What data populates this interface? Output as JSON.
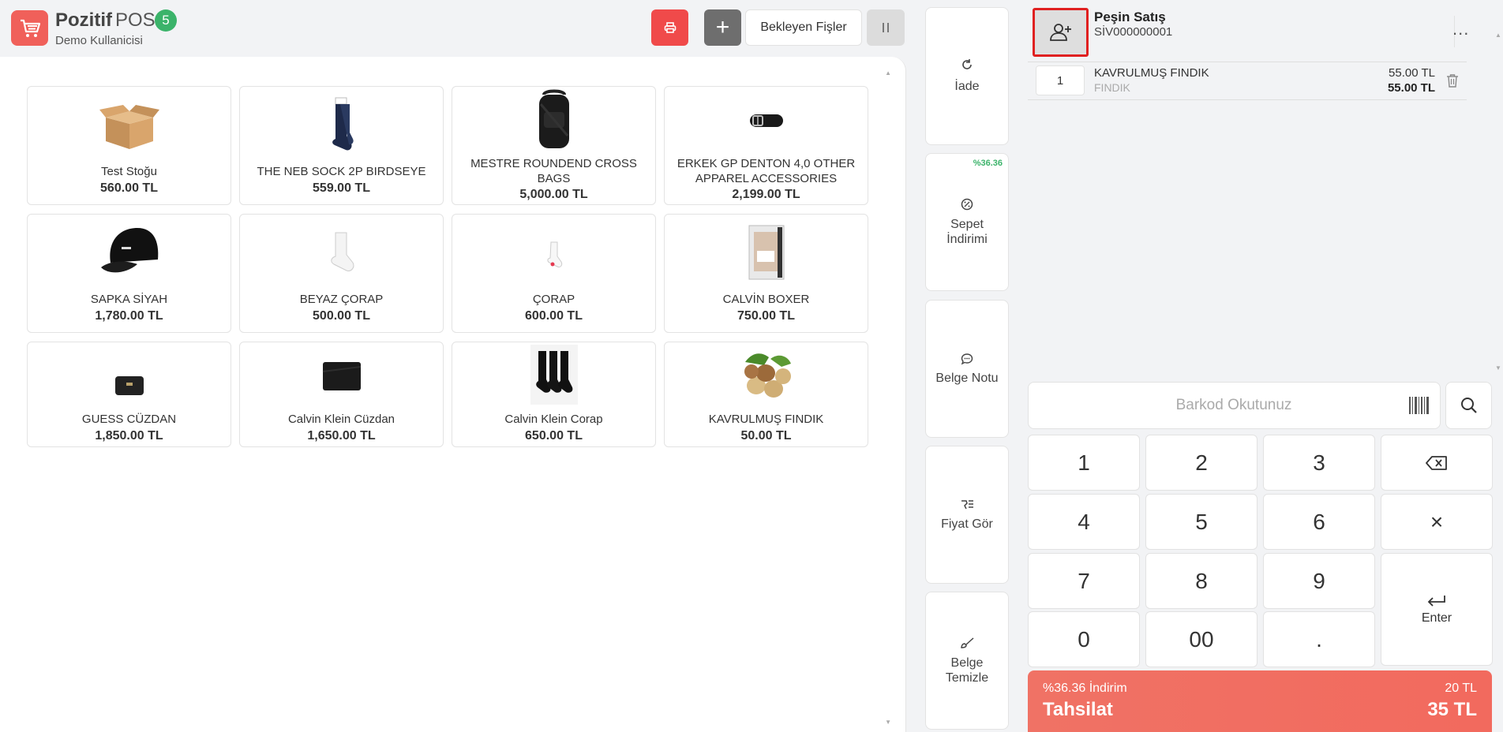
{
  "header": {
    "brand_bold": "Pozitif",
    "brand_light": "POS",
    "badge": "5",
    "user": "Demo Kullanicisi",
    "pending_label": "Bekleyen Fişler",
    "plus_label": "+"
  },
  "products": [
    {
      "name": "Test Stoğu",
      "price": "560.00 TL",
      "icon": "cardboard-box"
    },
    {
      "name": "THE NEB SOCK 2P BIRDSEYE",
      "price": "559.00 TL",
      "icon": "navy-socks"
    },
    {
      "name": "MESTRE ROUNDEND CROSS BAGS",
      "price": "5,000.00 TL",
      "icon": "black-backpack"
    },
    {
      "name": "ERKEK GP DENTON 4,0 OTHER APPAREL ACCESSORIES",
      "price": "2,199.00 TL",
      "icon": "leather-belt"
    },
    {
      "name": "SAPKA SİYAH",
      "price": "1,780.00 TL",
      "icon": "black-cap"
    },
    {
      "name": "BEYAZ ÇORAP",
      "price": "500.00 TL",
      "icon": "white-sock"
    },
    {
      "name": "ÇORAP",
      "price": "600.00 TL",
      "icon": "small-sock"
    },
    {
      "name": "CALVİN BOXER",
      "price": "750.00 TL",
      "icon": "boxer-pack"
    },
    {
      "name": "GUESS CÜZDAN",
      "price": "1,850.00 TL",
      "icon": "small-wallet"
    },
    {
      "name": "Calvin Klein Cüzdan",
      "price": "1,650.00 TL",
      "icon": "black-wallet"
    },
    {
      "name": "Calvin Klein Corap",
      "price": "650.00 TL",
      "icon": "black-socks"
    },
    {
      "name": "KAVRULMUŞ FINDIK",
      "price": "50.00 TL",
      "icon": "hazelnuts"
    }
  ],
  "actions": [
    {
      "label": "İade",
      "icon": "refresh-icon",
      "tag": ""
    },
    {
      "label": "Sepet İndirimi",
      "icon": "discount-icon",
      "tag": "%36.36"
    },
    {
      "label": "Belge Notu",
      "icon": "note-icon",
      "tag": ""
    },
    {
      "label": "Fiyat Gör",
      "icon": "price-check-icon",
      "tag": ""
    },
    {
      "label": "Belge Temizle",
      "icon": "brush-icon",
      "tag": ""
    }
  ],
  "sale": {
    "title": "Peşin Satış",
    "number": "SİV000000001",
    "more": "..."
  },
  "cart": [
    {
      "qty": "1",
      "name": "KAVRULMUŞ FINDIK",
      "sub": "FINDIK",
      "unit_price": "55.00 TL",
      "total": "55.00 TL"
    }
  ],
  "barcode": {
    "placeholder": "Barkod Okutunuz"
  },
  "keypad": [
    "1",
    "2",
    "3",
    "4",
    "5",
    "6",
    "7",
    "8",
    "9",
    "0",
    "00",
    "."
  ],
  "keypad_actions": {
    "backspace": "backspace-icon",
    "clear": "×",
    "enter": "Enter"
  },
  "payment": {
    "discount_label": "%36.36 İndirim",
    "discount_amount": "20 TL",
    "title": "Tahsilat",
    "total": "35 TL"
  },
  "colors": {
    "accent": "#f0605a",
    "badge": "#3bb36a",
    "print": "#f04a4a",
    "pay": "#f07265",
    "highlight": "#e02020"
  }
}
